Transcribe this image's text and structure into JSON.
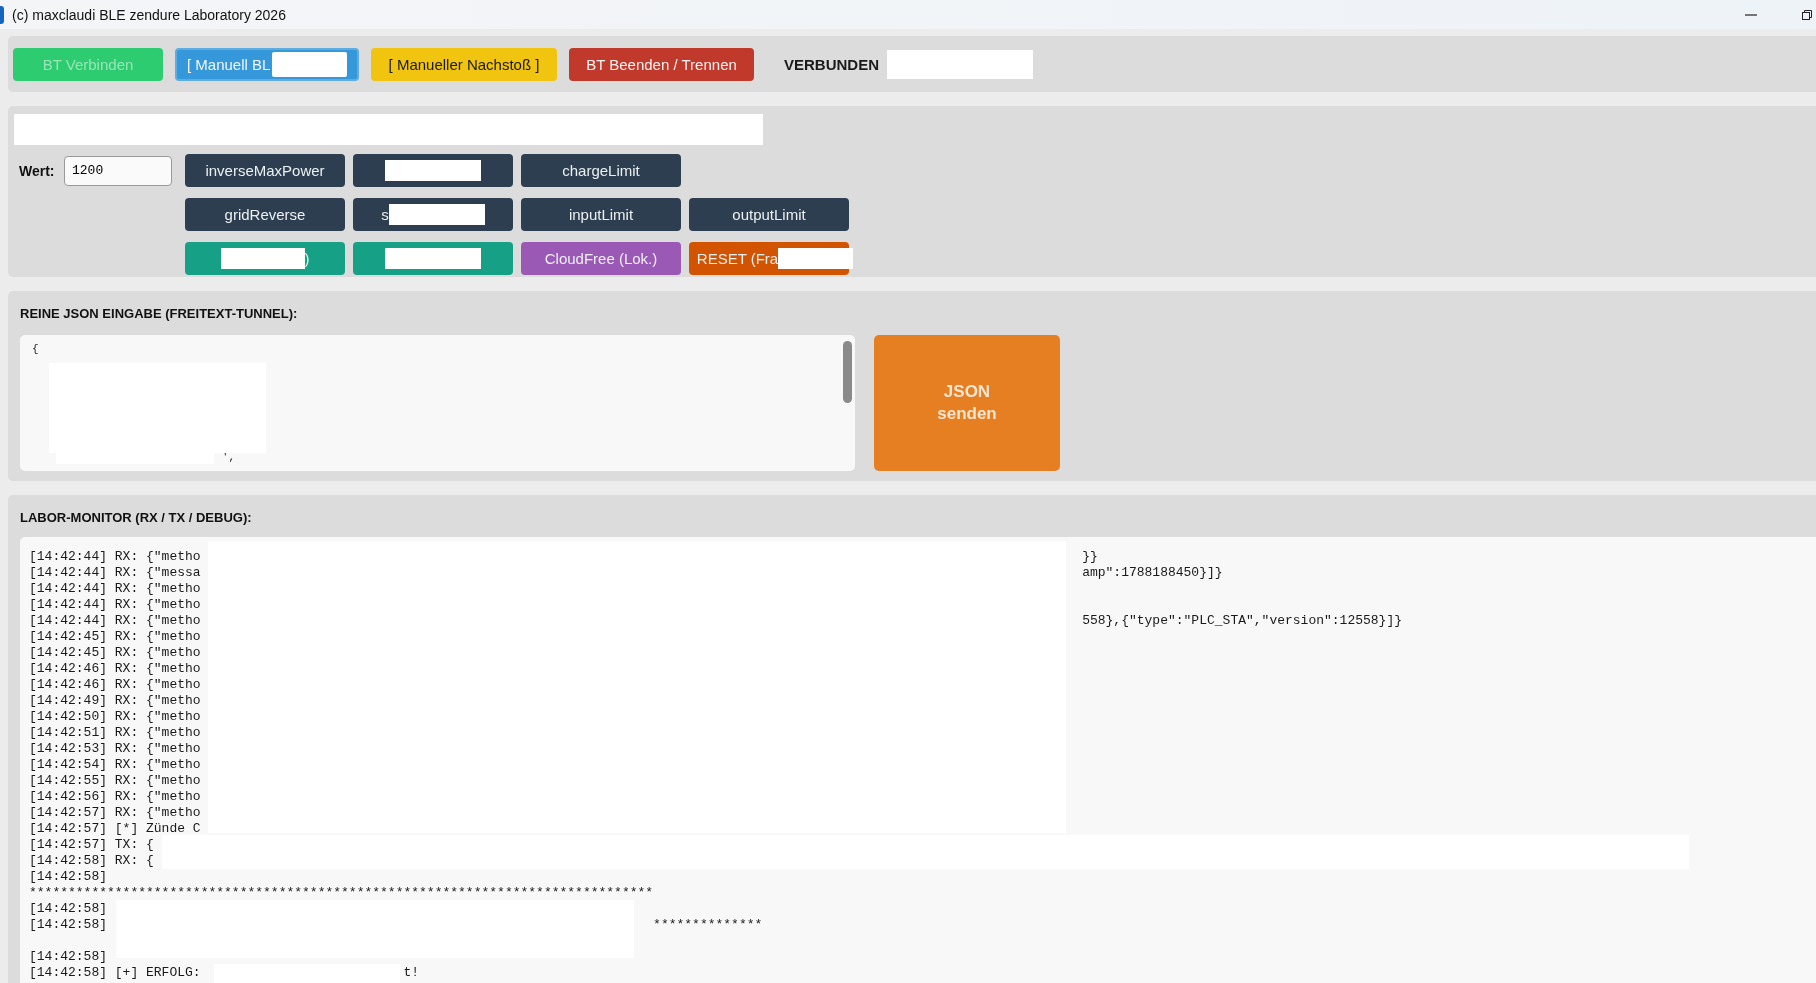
{
  "window": {
    "title": "(c) maxclaudi BLE zendure Laboratory 2026"
  },
  "connection_bar": {
    "buttons": [
      {
        "label": "BT Verbinden",
        "color": "#2ecc71",
        "disabled": true,
        "kind": "plain"
      },
      {
        "label": "[ Manuell BL",
        "color": "#3498db",
        "disabled": false,
        "kind": "tail"
      },
      {
        "label": "[ Manueller Nachstoß ]",
        "color": "#f1c40f",
        "disabled": false,
        "kind": "plain"
      },
      {
        "label": "BT Beenden / Trennen",
        "color": "#c0392b",
        "disabled": false,
        "kind": "plain"
      }
    ],
    "status": "VERBUNDEN"
  },
  "command_panel": {
    "value_label": "Wert:",
    "value": "1200",
    "rows": [
      [
        {
          "label": "inverseMaxPower",
          "color": "#2c3e50",
          "kind": "plain"
        },
        {
          "color": "#2c3e50",
          "kind": "full"
        },
        {
          "label": "chargeLimit",
          "color": "#2c3e50",
          "kind": "plain"
        }
      ],
      [
        {
          "label": "gridReverse",
          "color": "#2c3e50",
          "kind": "plain"
        },
        {
          "label": "s",
          "color": "#2c3e50",
          "kind": "tail"
        },
        {
          "label": "inputLimit",
          "color": "#2c3e50",
          "kind": "plain"
        },
        {
          "label": "outputLimit",
          "color": "#2c3e50",
          "kind": "plain"
        }
      ],
      [
        {
          "label": ")",
          "color": "#16a085",
          "kind": "head"
        },
        {
          "color": "#16a085",
          "kind": "full"
        },
        {
          "label": "CloudFree (Lok.)",
          "color": "#9b59b6",
          "kind": "plain"
        },
        {
          "label": "RESET (Fra",
          "color": "#d35400",
          "kind": "tail"
        }
      ]
    ]
  },
  "json_panel": {
    "title": "REINE JSON EINGABE (FREITEXT-TUNNEL):",
    "lines": [
      "{",
      "',"
    ],
    "send_button": "JSON senden"
  },
  "monitor": {
    "title": "LABOR-MONITOR (RX / TX / DEBUG):",
    "lines": [
      {
        "text": "[14:42:44] RX: {\"metho",
        "tail": "}}",
        "kind": "far"
      },
      {
        "text": "[14:42:44] RX: {\"messa",
        "tail": "amp\":1788188450}]}",
        "kind": "far"
      },
      {
        "text": "[14:42:44] RX: {\"metho",
        "kind": "plain"
      },
      {
        "text": "[14:42:44] RX: {\"metho",
        "kind": "plain"
      },
      {
        "text": "[14:42:44] RX: {\"metho",
        "tail": "558},{\"type\":\"PLC_STA\",\"version\":12558}]}",
        "kind": "far"
      },
      {
        "text": "[14:42:45] RX: {\"metho",
        "kind": "plain"
      },
      {
        "text": "[14:42:45] RX: {\"metho",
        "kind": "plain"
      },
      {
        "text": "[14:42:46] RX: {\"metho",
        "kind": "plain"
      },
      {
        "text": "[14:42:46] RX: {\"metho",
        "kind": "plain"
      },
      {
        "text": "[14:42:49] RX: {\"metho",
        "kind": "plain"
      },
      {
        "text": "[14:42:50] RX: {\"metho",
        "kind": "plain"
      },
      {
        "text": "[14:42:51] RX: {\"metho",
        "kind": "plain"
      },
      {
        "text": "[14:42:53] RX: {\"metho",
        "kind": "plain"
      },
      {
        "text": "[14:42:54] RX: {\"metho",
        "kind": "plain"
      },
      {
        "text": "[14:42:55] RX: {\"metho",
        "kind": "plain"
      },
      {
        "text": "[14:42:56] RX: {\"metho",
        "kind": "plain"
      },
      {
        "text": "[14:42:57] RX: {\"metho",
        "kind": "plain"
      },
      {
        "text": "[14:42:57] [*] Zünde C",
        "kind": "plain"
      },
      {
        "text": "[14:42:57] TX: {",
        "kind": "plain"
      },
      {
        "text": "[14:42:58] RX: {",
        "kind": "plain"
      },
      {
        "text": "[14:42:58]",
        "kind": "plain"
      },
      {
        "text": "********************************************************************************",
        "kind": "plain"
      },
      {
        "text": "[14:42:58]",
        "kind": "plain"
      },
      {
        "text": "[14:42:58]",
        "tail": "**************",
        "kind": "near"
      },
      {
        "kind": "blank"
      },
      {
        "text": "[14:42:58]",
        "kind": "plain"
      },
      {
        "text": "[14:42:58] [+] ERFOLG:",
        "tail": "t!",
        "kind": "mid"
      }
    ]
  }
}
